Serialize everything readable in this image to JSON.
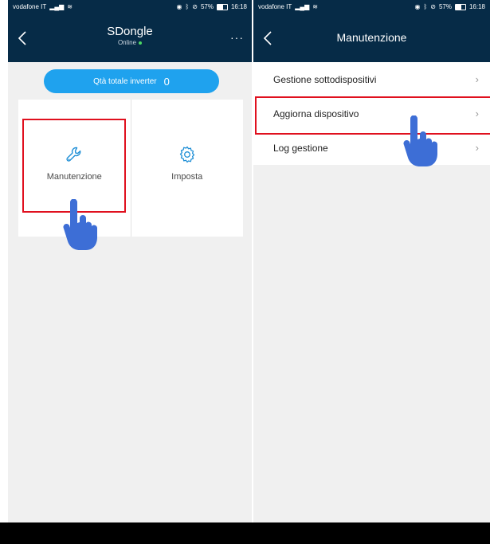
{
  "left_screen": {
    "status_bar": {
      "carrier": "vodafone IT",
      "battery": "57%",
      "time": "16:18",
      "battery_level": 0.57
    },
    "header": {
      "title": "SDongle",
      "subtitle": "Online",
      "menu_label": "···"
    },
    "inverter_summary": {
      "label": "Qtà totale inverter",
      "count": "0"
    },
    "tiles": [
      {
        "label": "Manutenzione",
        "icon": "wrench-icon"
      },
      {
        "label": "Imposta",
        "icon": "gear-icon"
      }
    ]
  },
  "right_screen": {
    "status_bar": {
      "carrier": "vodafone IT",
      "battery": "57%",
      "time": "16:18",
      "battery_level": 0.57
    },
    "header": {
      "title": "Manutenzione"
    },
    "menu_items": [
      {
        "label": "Gestione sottodispositivi"
      },
      {
        "label": "Aggiorna dispositivo"
      },
      {
        "label": "Log gestione"
      }
    ]
  },
  "colors": {
    "header_bg": "#062b47",
    "accent_blue": "#1fa2ee",
    "highlight_red": "#e0101e",
    "hand_blue": "#3d6ed6",
    "online_green": "#4cd964"
  }
}
